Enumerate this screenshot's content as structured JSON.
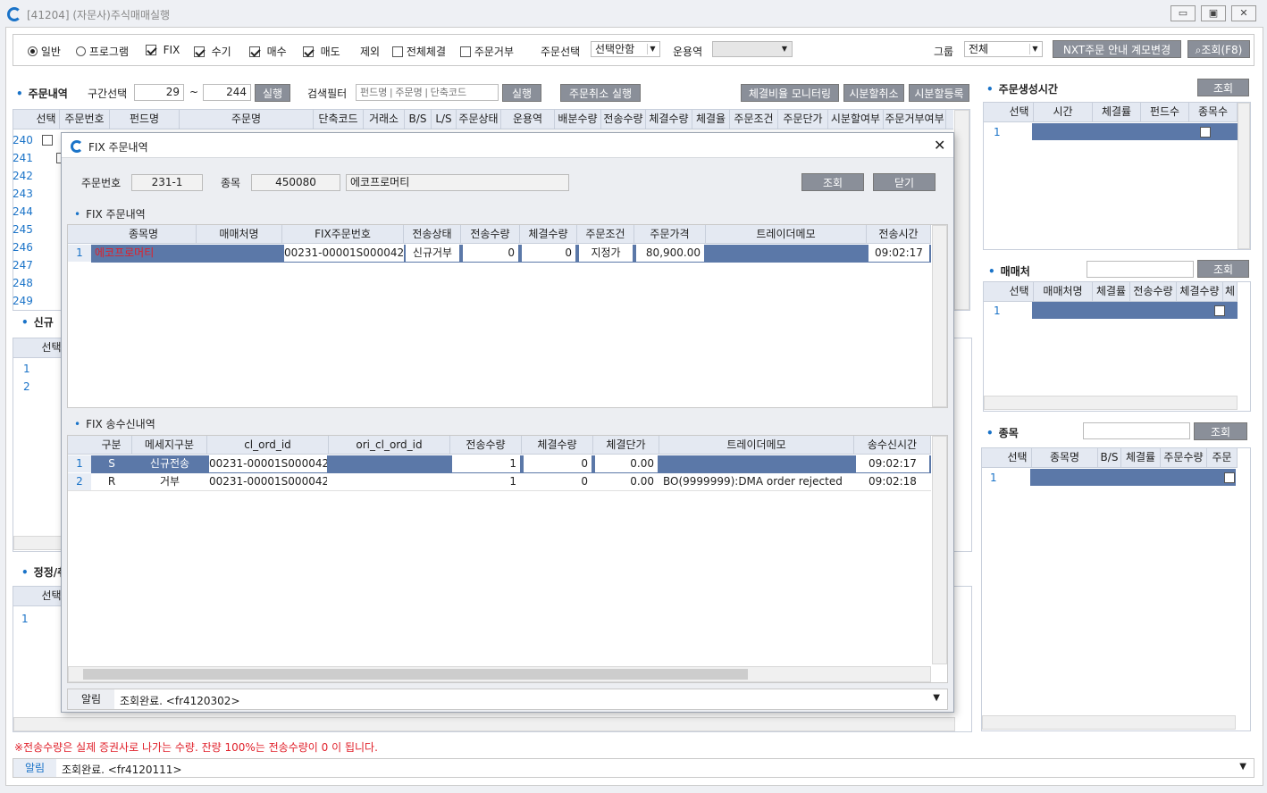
{
  "window": {
    "title": "[41204] (자문사)주식매매실행",
    "btn_min": "▭",
    "btn_max": "▣",
    "btn_close": "✕"
  },
  "toolbar": {
    "normal": "일반",
    "program": "프로그램",
    "fix": "FIX",
    "manual": "수기",
    "buy": "매수",
    "sell": "매도",
    "exclude": "제외",
    "all_fill": "전체체결",
    "order_reject": "주문거부",
    "order_select_label": "주문선택",
    "order_select_value": "선택안함",
    "fund_manager_label": "운용역",
    "group_label": "그룹",
    "group_value": "전체",
    "nxt_btn": "NXT주문 안내 계모변경",
    "query_btn": "조회(F8)"
  },
  "orders": {
    "title": "주문내역",
    "range_label": "구간선택",
    "range_from": "29",
    "range_sep": "~",
    "range_to": "244",
    "run_btn": "실행",
    "filter_label": "검색필터",
    "filter_placeholder": "펀드명 | 주문명 | 단축코드",
    "filter_run": "실행",
    "cancel_run": "주문취소 실행",
    "monitor_btn": "체결비율 모니터링",
    "split_cancel": "시분할취소",
    "split_register": "시분할등록",
    "columns": [
      "선택",
      "주문번호",
      "펀드명",
      "주문명",
      "단축코드",
      "거래소",
      "B/S",
      "L/S",
      "주문상태",
      "운용역",
      "배분수량",
      "전송수량",
      "체결수량",
      "체결율",
      "주문조건",
      "주문단가",
      "시분할여부",
      "주문거부여부"
    ],
    "rows": [
      "240",
      "241",
      "242",
      "243",
      "244",
      "245",
      "246",
      "247",
      "248",
      "249"
    ]
  },
  "new_section": {
    "title": "신규",
    "col": "선택",
    "rows": [
      "1",
      "2"
    ]
  },
  "modify_section": {
    "title": "정정/취",
    "col": "선택",
    "rows": [
      "1"
    ]
  },
  "notice": "※전송수량은 실제 증권사로 나가는 수량. 잔량 100%는 전송수량이 0 이 됩니다.",
  "status": {
    "label": "알림",
    "text": "조회완료. <fr4120111>"
  },
  "right": {
    "gen_title": "주문생성시간",
    "gen_btn": "조회",
    "gen_cols": [
      "선택",
      "시간",
      "체결률",
      "펀드수",
      "종목수"
    ],
    "broker_title": "매매처",
    "broker_btn": "조회",
    "broker_cols": [
      "선택",
      "매매처명",
      "체결률",
      "전송수량",
      "체결수량",
      "체"
    ],
    "item_title": "종목",
    "item_btn": "조회",
    "item_cols": [
      "선택",
      "종목명",
      "B/S",
      "체결률",
      "주문수량",
      "주문"
    ],
    "row1": "1"
  },
  "dialog": {
    "title": "FIX 주문내역",
    "order_no_label": "주문번호",
    "order_no": "231-1",
    "item_label": "종목",
    "item_code": "450080",
    "item_name": "에코프로머티",
    "query_btn": "조회",
    "close_btn": "닫기",
    "sec1_title": "FIX 주문내역",
    "sec1_cols": [
      "종목명",
      "매매처명",
      "FIX주문번호",
      "전송상태",
      "전송수량",
      "체결수량",
      "주문조건",
      "주문가격",
      "트레이더메모",
      "전송시간"
    ],
    "sec1_rows": [
      {
        "no": "1",
        "name": "에코프로머티",
        "broker": "",
        "fix_no": "00231-00001S0000422",
        "state": "신규거부",
        "sent": "0",
        "filled": "0",
        "cond": "지정가",
        "price": "80,900.00",
        "memo": "",
        "time": "09:02:17"
      }
    ],
    "sec2_title": "FIX 송수신내역",
    "sec2_cols": [
      "구분",
      "메세지구분",
      "cl_ord_id",
      "ori_cl_ord_id",
      "전송수량",
      "체결수량",
      "체결단가",
      "트레이더메모",
      "송수신시간"
    ],
    "sec2_rows": [
      {
        "no": "1",
        "kind": "S",
        "msg": "신규전송",
        "cl": "00231-00001S0000422",
        "ori": "",
        "sent": "1",
        "filled": "0",
        "price": "0.00",
        "memo": "",
        "time": "09:02:17"
      },
      {
        "no": "2",
        "kind": "R",
        "msg": "거부",
        "cl": "00231-00001S0000422",
        "ori": "",
        "sent": "1",
        "filled": "0",
        "price": "0.00",
        "memo": "BO(9999999):DMA order rejected",
        "time": "09:02:18"
      }
    ],
    "status_label": "알림",
    "status_text": "조회완료. <fr4120302>"
  },
  "colors": {
    "accent": "#1a73c8",
    "selected_row": "#5b78a8",
    "button": "#8a8f99",
    "red_text": "#e0202a"
  }
}
